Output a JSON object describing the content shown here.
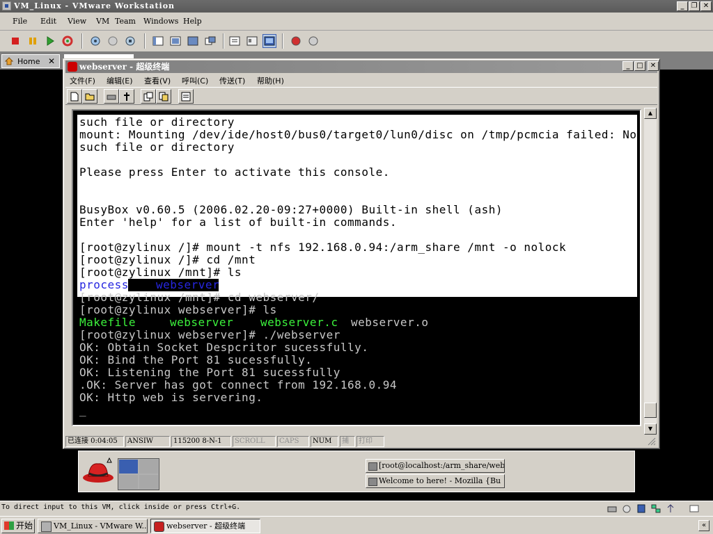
{
  "vmware": {
    "title": "VM_Linux - VMware Workstation",
    "menus": [
      "File",
      "Edit",
      "View",
      "VM",
      "Team",
      "Windows",
      "Help"
    ],
    "tabs": {
      "home": "Home"
    },
    "status_text": "To direct input to this VM, click inside or press Ctrl+G."
  },
  "hyperterminal": {
    "title": "webserver - 超级终端",
    "menus": [
      "文件(F)",
      "编辑(E)",
      "查看(V)",
      "呼叫(C)",
      "传送(T)",
      "帮助(H)"
    ],
    "terminal_lines": [
      "such file or directory",
      "mount: Mounting /dev/ide/host0/bus0/target0/lun0/disc on /tmp/pcmcia failed: No",
      "such file or directory",
      "",
      "Please press Enter to activate this console.",
      "",
      "",
      "BusyBox v0.60.5 (2006.02.20-09:27+0000) Built-in shell (ash)",
      "Enter 'help' for a list of built-in commands.",
      "",
      "[root@zylinux /]# mount -t nfs 192.168.0.94:/arm_share /mnt -o nolock",
      "[root@zylinux /]# cd /mnt",
      "[root@zylinux /mnt]# ls"
    ],
    "ls_mnt": {
      "process": "process",
      "webserver": "webserver"
    },
    "terminal_lines_after": [
      "[root@zylinux /mnt]# cd webserver/",
      "[root@zylinux webserver]# ls"
    ],
    "ls_webserver": {
      "makefile": "Makefile",
      "webserver": "webserver",
      "webserver_c": "webserver.c",
      "webserver_o": "webserver.o"
    },
    "terminal_lines_end": [
      "[root@zylinux webserver]# ./webserver",
      "OK: Obtain Socket Despcritor sucessfully.",
      "OK: Bind the Port 81 sucessfully.",
      "OK: Listening the Port 81 sucessfully",
      ".OK: Server has got connect from 192.168.0.94",
      "OK: Http web is servering.",
      "",
      "_"
    ],
    "status": {
      "connected": "已连接 0:04:05",
      "emulation": "ANSIW",
      "port": "115200 8-N-1",
      "scroll": "SCROLL",
      "caps": "CAPS",
      "num": "NUM",
      "capture": "捕",
      "print": "打印"
    }
  },
  "guest_panel": {
    "tasks": [
      "[root@localhost:/arm_share/webser",
      "Welcome to here! - Mozilla {Bu"
    ]
  },
  "taskbar": {
    "start": "开始",
    "items": [
      "VM_Linux - VMware W...",
      "webserver - 超级终端"
    ]
  },
  "colors": {
    "terminal_bg": "#000000",
    "ls_green": "#3cf23c",
    "ls_blue": "#2626e0"
  }
}
